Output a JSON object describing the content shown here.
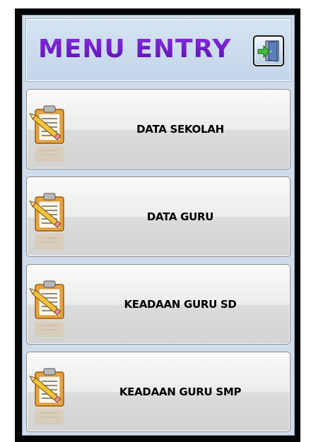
{
  "header": {
    "title": "MENU ENTRY",
    "exit_icon": "exit-door-icon"
  },
  "menu": {
    "items": [
      {
        "label": "DATA SEKOLAH",
        "icon": "clipboard-pencil-icon"
      },
      {
        "label": "DATA GURU",
        "icon": "clipboard-pencil-icon"
      },
      {
        "label": "KEADAAN GURU SD",
        "icon": "clipboard-pencil-icon"
      },
      {
        "label": "KEADAAN GURU SMP",
        "icon": "clipboard-pencil-icon"
      }
    ]
  },
  "colors": {
    "title": "#6a18c2",
    "panel_background": "#cfdcec",
    "frame": "#050505"
  }
}
